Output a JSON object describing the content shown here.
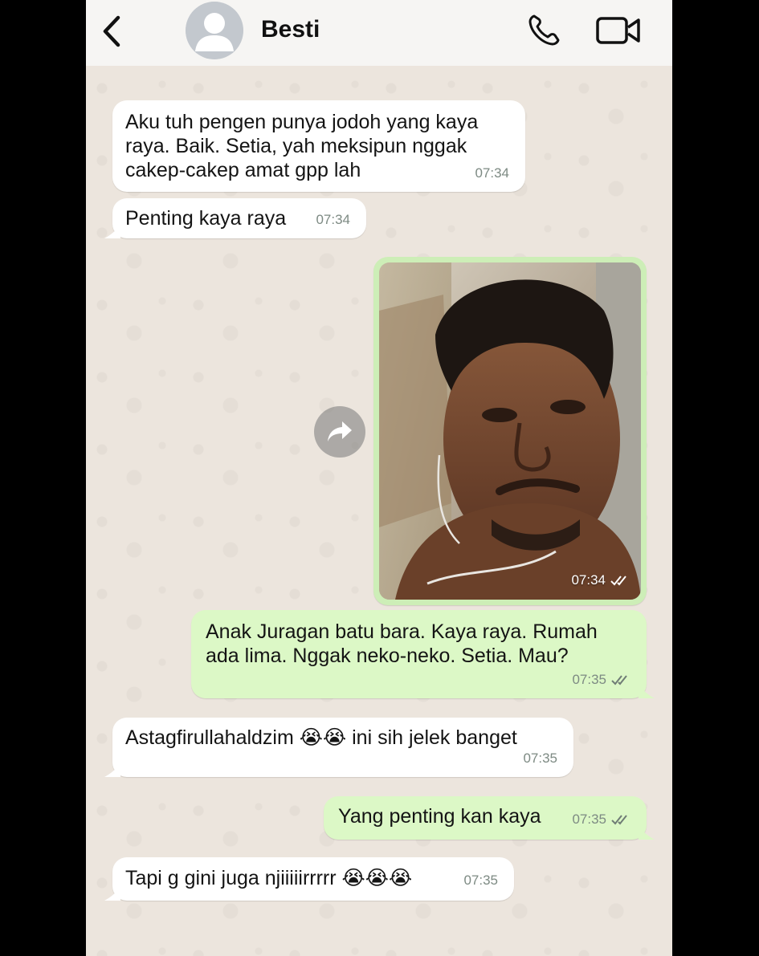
{
  "header": {
    "contact_name": "Besti"
  },
  "messages": [
    {
      "direction": "incoming",
      "text": "Aku tuh pengen punya jodoh yang kaya\nraya. Baik. Setia, yah meksipun nggak\ncakep-cakep amat gpp lah",
      "time": "07:34"
    },
    {
      "direction": "incoming",
      "text": "Penting kaya raya",
      "time": "07:34"
    },
    {
      "direction": "outgoing",
      "type": "image",
      "time": "07:34",
      "status": "read"
    },
    {
      "direction": "outgoing",
      "text": "Anak Juragan batu bara. Kaya raya. Rumah\nada lima. Nggak neko-neko. Setia. Mau?",
      "time": "07:35",
      "status": "read"
    },
    {
      "direction": "incoming",
      "text": "Astagfirullahaldzim 😭😭 ini sih jelek banget",
      "time": "07:35"
    },
    {
      "direction": "outgoing",
      "text": "Yang penting kan kaya",
      "time": "07:35",
      "status": "read"
    },
    {
      "direction": "incoming",
      "text": "Tapi g gini juga njiiiiirrrrr 😭😭😭",
      "time": "07:35"
    }
  ],
  "colors": {
    "incoming_bubble": "#ffffff",
    "outgoing_bubble": "#dcf8c6",
    "chat_background": "#ece5dd",
    "header_background": "#f6f5f3"
  },
  "icons": [
    "back-arrow-icon",
    "avatar-icon",
    "phone-icon",
    "video-camera-icon",
    "forward-icon",
    "double-check-icon"
  ]
}
